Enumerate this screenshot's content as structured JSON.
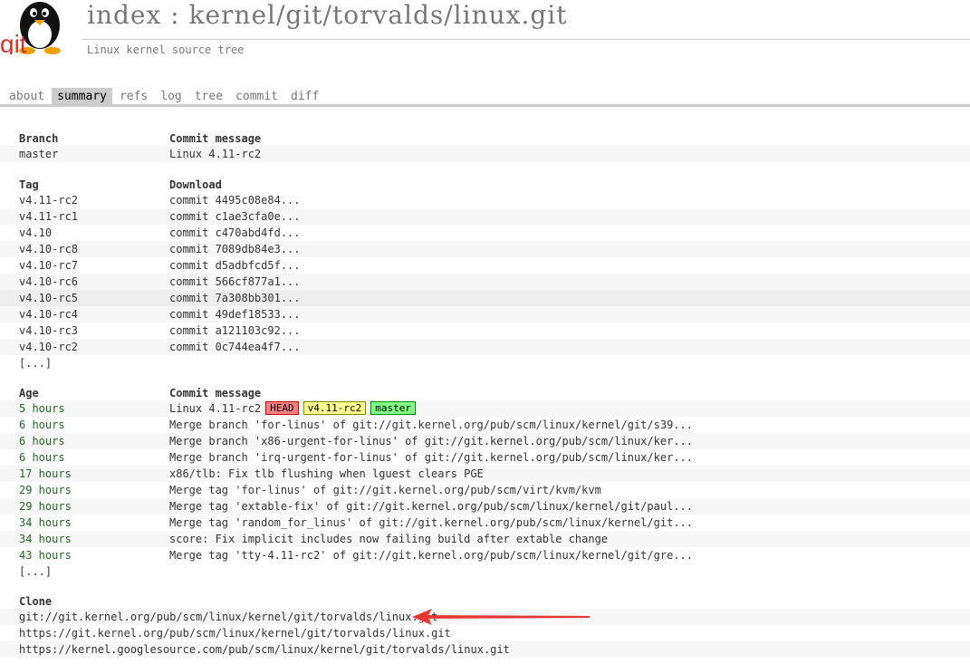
{
  "header": {
    "logo_text": "git",
    "title": "index : kernel/git/torvalds/linux.git",
    "subtitle": "Linux kernel source tree"
  },
  "tabs": [
    {
      "label": "about",
      "active": false
    },
    {
      "label": "summary",
      "active": true
    },
    {
      "label": "refs",
      "active": false
    },
    {
      "label": "log",
      "active": false
    },
    {
      "label": "tree",
      "active": false
    },
    {
      "label": "commit",
      "active": false
    },
    {
      "label": "diff",
      "active": false
    }
  ],
  "branches": {
    "headers": [
      "Branch",
      "Commit message"
    ],
    "rows": [
      [
        "master",
        "Linux 4.11-rc2"
      ]
    ]
  },
  "tags": {
    "headers": [
      "Tag",
      "Download"
    ],
    "rows": [
      [
        "v4.11-rc2",
        "commit 4495c08e84..."
      ],
      [
        "v4.11-rc1",
        "commit c1ae3cfa0e..."
      ],
      [
        "v4.10",
        "commit c470abd4fd..."
      ],
      [
        "v4.10-rc8",
        "commit 7089db84e3..."
      ],
      [
        "v4.10-rc7",
        "commit d5adbfcd5f..."
      ],
      [
        "v4.10-rc6",
        "commit 566cf877a1..."
      ],
      [
        "v4.10-rc5",
        "commit 7a308bb301..."
      ],
      [
        "v4.10-rc4",
        "commit 49def18533..."
      ],
      [
        "v4.10-rc3",
        "commit a121103c92..."
      ],
      [
        "v4.10-rc2",
        "commit 0c744ea4f7..."
      ]
    ],
    "more": "[...]"
  },
  "log": {
    "headers": [
      "Age",
      "Commit message"
    ],
    "rows": [
      [
        "5 hours",
        "Linux 4.11-rc2"
      ],
      [
        "6 hours",
        "Merge branch 'for-linus' of git://git.kernel.org/pub/scm/linux/kernel/git/s39..."
      ],
      [
        "6 hours",
        "Merge branch 'x86-urgent-for-linus' of git://git.kernel.org/pub/scm/linux/ker..."
      ],
      [
        "6 hours",
        "Merge branch 'irq-urgent-for-linus' of git://git.kernel.org/pub/scm/linux/ker..."
      ],
      [
        "17 hours",
        "x86/tlb: Fix tlb flushing when lguest clears PGE"
      ],
      [
        "29 hours",
        "Merge tag 'for-linus' of git://git.kernel.org/pub/scm/virt/kvm/kvm"
      ],
      [
        "29 hours",
        "Merge tag 'extable-fix' of git://git.kernel.org/pub/scm/linux/kernel/git/paul..."
      ],
      [
        "34 hours",
        "Merge tag 'random_for_linus' of git://git.kernel.org/pub/scm/linux/kernel/git..."
      ],
      [
        "34 hours",
        "score: Fix implicit includes now failing build after extable change"
      ],
      [
        "43 hours",
        "Merge tag 'tty-4.11-rc2' of git://git.kernel.org/pub/scm/linux/kernel/git/gre..."
      ]
    ],
    "badges": {
      "head": "HEAD",
      "tag": "v4.11-rc2",
      "branch": "master"
    },
    "more": "[...]"
  },
  "clone": {
    "header": "Clone",
    "urls": [
      "git://git.kernel.org/pub/scm/linux/kernel/git/torvalds/linux.git",
      "https://git.kernel.org/pub/scm/linux/kernel/git/torvalds/linux.git",
      "https://kernel.googlesource.com/pub/scm/linux/kernel/git/torvalds/linux.git"
    ]
  },
  "colors": {
    "age": "#262",
    "annotation_arrow": "#e53935",
    "tab_active_bg": "#ccc"
  }
}
